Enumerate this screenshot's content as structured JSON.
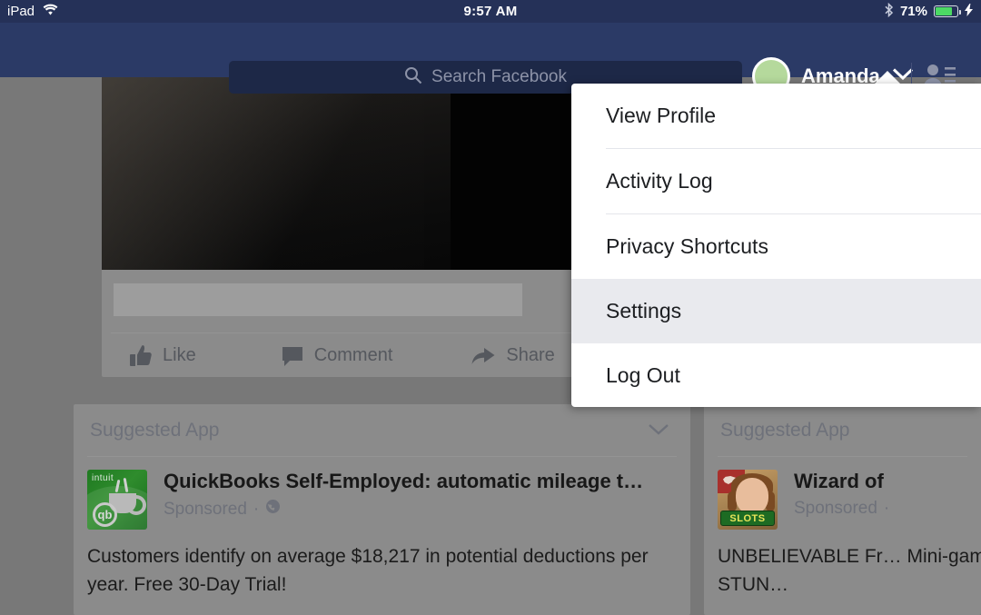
{
  "status_bar": {
    "device": "iPad",
    "wifi_icon": "wifi-icon",
    "time": "9:57 AM",
    "bluetooth_icon": "bluetooth-icon",
    "battery_percent": "71%",
    "battery_level": 71,
    "charging_icon": "lightning-bolt-icon"
  },
  "nav": {
    "search": {
      "placeholder": "Search Facebook",
      "value": "",
      "icon": "search-icon"
    },
    "profile": {
      "name": "Amanda",
      "avatar": "avatar",
      "chevron": "chevron-down-icon"
    },
    "friend_requests_icon": "friend-requests-icon"
  },
  "menu": {
    "items": [
      {
        "label": "View Profile",
        "active": false
      },
      {
        "label": "Activity Log",
        "active": false
      },
      {
        "label": "Privacy Shortcuts",
        "active": false
      },
      {
        "label": "Settings",
        "active": true
      },
      {
        "label": "Log Out",
        "active": false
      }
    ],
    "highlight_color": "#e9eaee"
  },
  "feed": {
    "post": {
      "actions": [
        {
          "label": "Like",
          "icon": "thumbs-up-icon"
        },
        {
          "label": "Comment",
          "icon": "comment-bubble-icon"
        },
        {
          "label": "Share",
          "icon": "share-arrow-icon"
        }
      ]
    },
    "suggested_left": {
      "header": "Suggested App",
      "collapse_icon": "chevron-down-icon",
      "app_icon": "quickbooks-app-icon",
      "icon_brand": "intuit",
      "icon_badge": "qb",
      "title": "QuickBooks Self-Employed: automatic mileage t…",
      "sponsored": "Sponsored",
      "separator": "·",
      "globe_icon": "globe-icon",
      "description": "Customers identify on average $18,217 in potential deductions per year. Free 30-Day Trial!"
    },
    "suggested_right": {
      "header": "Suggested App",
      "app_icon": "wizard-of-oz-slots-app-icon",
      "icon_badge": "SLOTS",
      "title": "Wizard of",
      "sponsored": "Sponsored",
      "separator": "·",
      "description": "UNBELIEVABLE Fr… Mini-games, STUN…"
    }
  },
  "colors": {
    "status_bar_bg": "#253158",
    "nav_bg": "#2b3a66",
    "search_bg": "#1d2847",
    "avatar_green": "#b5d99c",
    "battery_green": "#4cd964",
    "menu_bg": "#ffffff",
    "dim_overlay": "#787878"
  }
}
